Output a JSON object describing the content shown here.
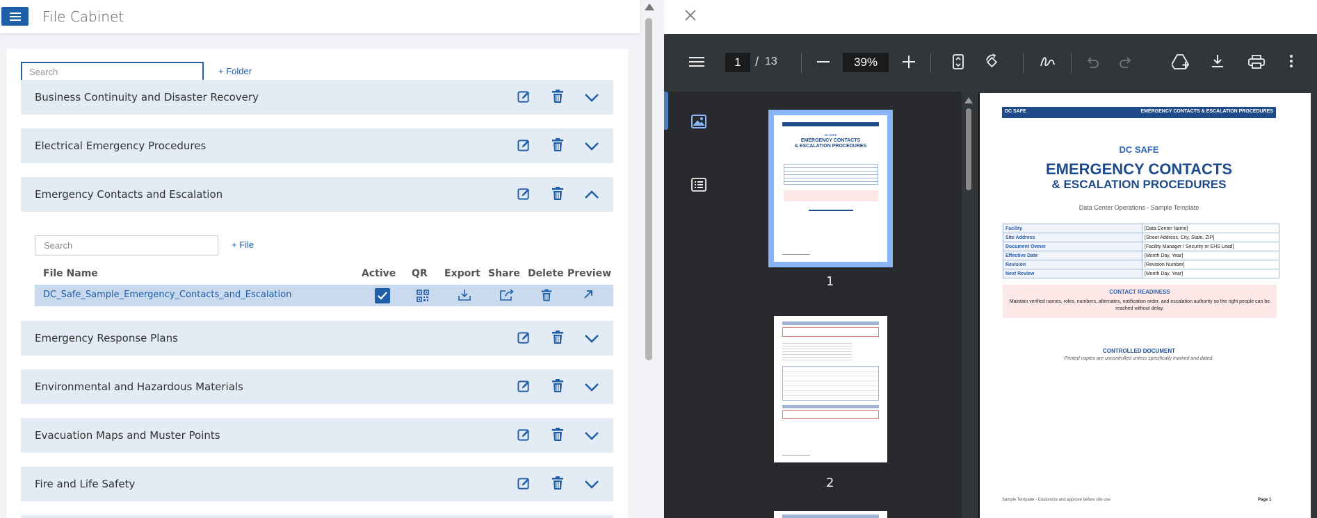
{
  "app": {
    "title": "File Cabinet"
  },
  "cabinet": {
    "search_placeholder": "Search",
    "add_folder_label": "+ Folder",
    "folders": [
      {
        "label": "Business Continuity and Disaster Recovery",
        "expanded": false
      },
      {
        "label": "Electrical Emergency Procedures",
        "expanded": false
      },
      {
        "label": "Emergency Contacts and Escalation",
        "expanded": true
      },
      {
        "label": "Emergency Response Plans",
        "expanded": false
      },
      {
        "label": "Environmental and Hazardous Materials",
        "expanded": false
      },
      {
        "label": "Evacuation Maps and Muster Points",
        "expanded": false
      },
      {
        "label": "Fire and Life Safety",
        "expanded": false
      }
    ],
    "expanded_folder": {
      "file_search_placeholder": "Search",
      "add_file_label": "+ File",
      "columns": [
        "File Name",
        "Active",
        "QR",
        "Export",
        "Share",
        "Delete",
        "Preview"
      ],
      "files": [
        {
          "name": "DC_Safe_Sample_Emergency_Contacts_and_Escalation",
          "active": true
        }
      ]
    }
  },
  "viewer": {
    "current_page": "1",
    "page_separator": "/",
    "total_pages": "13",
    "zoom": "39%",
    "thumbnails": [
      {
        "label": "1",
        "selected": true
      },
      {
        "label": "2",
        "selected": false
      }
    ],
    "page": {
      "header_left": "DC SAFE",
      "header_right": "EMERGENCY CONTACTS & ESCALATION PROCEDURES",
      "org": "DC SAFE",
      "title_line1": "EMERGENCY CONTACTS",
      "title_line2": "& ESCALATION PROCEDURES",
      "subtitle": "Data Center Operations - Sample Template",
      "info_rows": [
        {
          "key": "Facility",
          "value": "[Data Center Name]"
        },
        {
          "key": "Site Address",
          "value": "[Street Address, City, State, ZIP]"
        },
        {
          "key": "Document Owner",
          "value": "[Facility Manager / Security or EHS Lead]"
        },
        {
          "key": "Effective Date",
          "value": "[Month Day, Year]"
        },
        {
          "key": "Revision",
          "value": "[Revision Number]"
        },
        {
          "key": "Next Review",
          "value": "[Month Day, Year]"
        }
      ],
      "readiness_heading": "CONTACT READINESS",
      "readiness_body": "Maintain verified names, roles, numbers, alternates, notification order, and escalation authority so the right people can be reached without delay.",
      "controlled_heading": "CONTROLLED DOCUMENT",
      "controlled_note": "Printed copies are uncontrolled unless specifically marked and dated.",
      "footer_left": "Sample Template - Customize and approve before site use",
      "footer_right": "Page 1"
    }
  },
  "colors": {
    "accent": "#1f5ea8",
    "folder_bg": "#e3ebf5",
    "selected_row": "#c9d9ee",
    "viewer_bg": "#323639"
  }
}
